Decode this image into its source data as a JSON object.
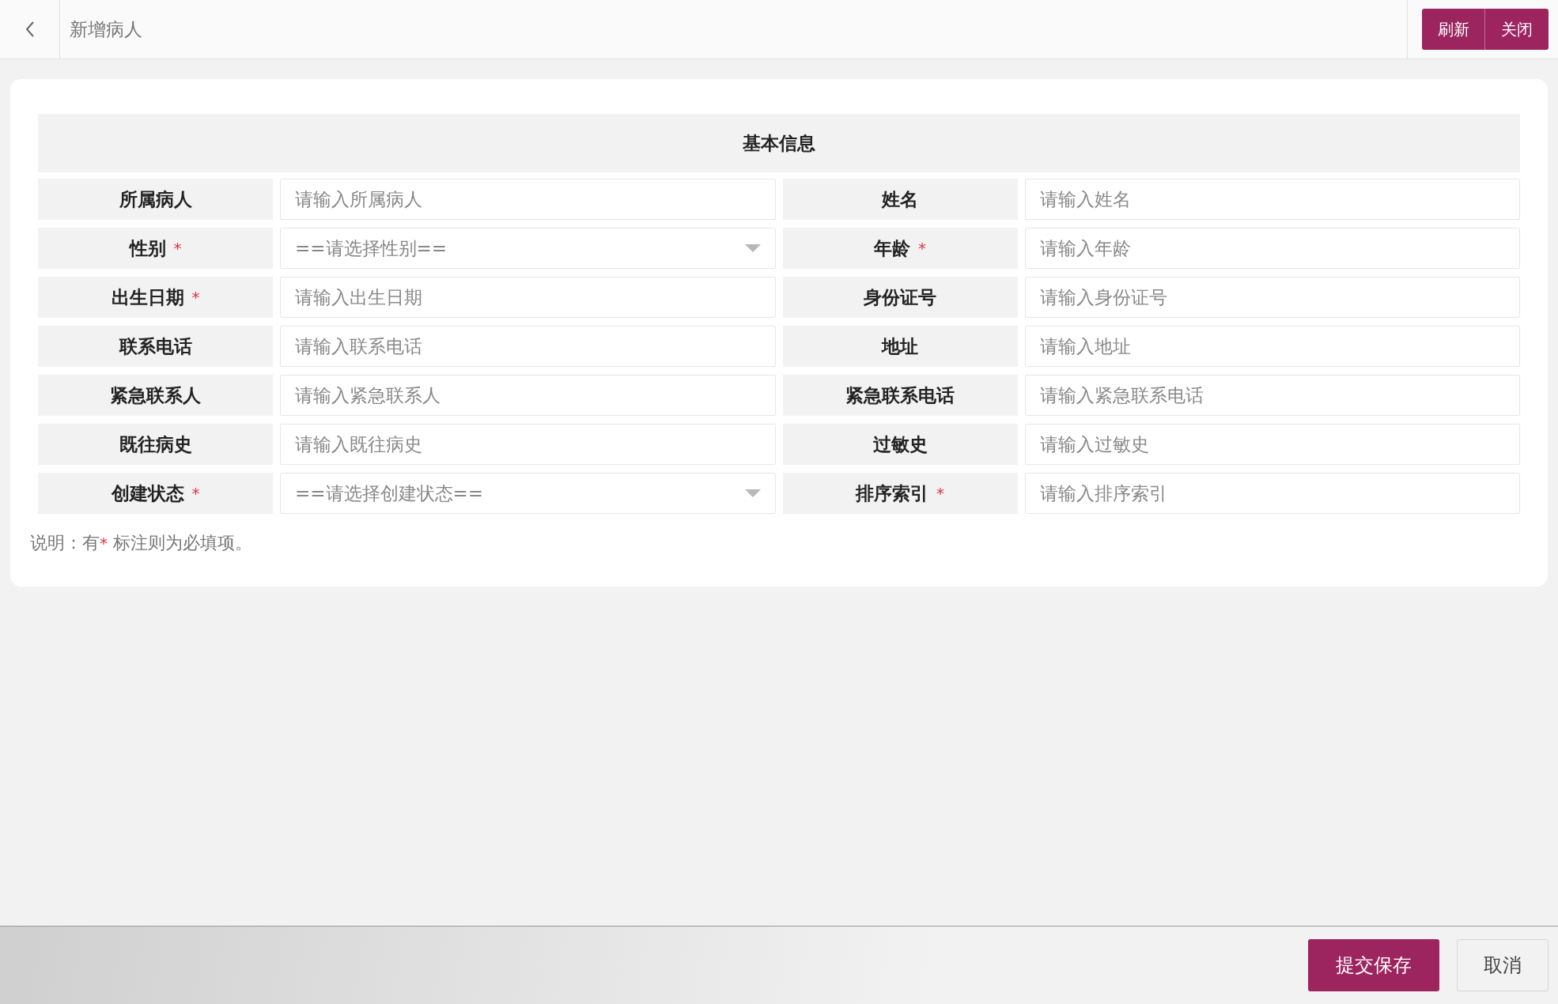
{
  "header": {
    "title": "新增病人",
    "buttons": [
      {
        "label": "刷新"
      },
      {
        "label": "关闭"
      }
    ]
  },
  "form": {
    "section_title": "基本信息",
    "required_mark": "*",
    "fields": [
      {
        "label": "所属病人",
        "required": false,
        "kind": "input",
        "placeholder": "请输入所属病人"
      },
      {
        "label": "姓名",
        "required": false,
        "kind": "input",
        "placeholder": "请输入姓名"
      },
      {
        "label": "性别",
        "required": true,
        "kind": "select",
        "placeholder": "==请选择性别=="
      },
      {
        "label": "年龄",
        "required": true,
        "kind": "input",
        "placeholder": "请输入年龄"
      },
      {
        "label": "出生日期",
        "required": true,
        "kind": "input",
        "placeholder": "请输入出生日期"
      },
      {
        "label": "身份证号",
        "required": false,
        "kind": "input",
        "placeholder": "请输入身份证号"
      },
      {
        "label": "联系电话",
        "required": false,
        "kind": "input",
        "placeholder": "请输入联系电话"
      },
      {
        "label": "地址",
        "required": false,
        "kind": "input",
        "placeholder": "请输入地址"
      },
      {
        "label": "紧急联系人",
        "required": false,
        "kind": "input",
        "placeholder": "请输入紧急联系人"
      },
      {
        "label": "紧急联系电话",
        "required": false,
        "kind": "input",
        "placeholder": "请输入紧急联系电话"
      },
      {
        "label": "既往病史",
        "required": false,
        "kind": "input",
        "placeholder": "请输入既往病史"
      },
      {
        "label": "过敏史",
        "required": false,
        "kind": "input",
        "placeholder": "请输入过敏史"
      },
      {
        "label": "创建状态",
        "required": true,
        "kind": "select",
        "placeholder": "==请选择创建状态=="
      },
      {
        "label": "排序索引",
        "required": true,
        "kind": "input",
        "placeholder": "请输入排序索引"
      }
    ],
    "note": {
      "before": "说明：有",
      "mark": "*",
      "after": " 标注则为必填项。"
    }
  },
  "footer": {
    "buttons": [
      {
        "label": "提交保存",
        "kind": "primary"
      },
      {
        "label": "取消",
        "kind": "secondary"
      }
    ]
  }
}
